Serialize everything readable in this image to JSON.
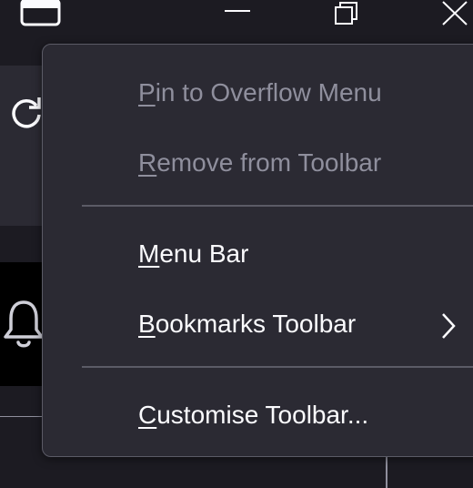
{
  "window": {
    "controls": {
      "minimize_icon": "minimize-icon",
      "restore_icon": "restore-icon",
      "close_icon": "close-icon"
    }
  },
  "background_icons": [
    "reload-icon",
    "bell-icon",
    "window-icon"
  ],
  "context_menu": {
    "items": [
      {
        "mnemonic": "P",
        "rest": "in to Overflow Menu",
        "enabled": false
      },
      {
        "mnemonic": "R",
        "rest": "emove from Toolbar",
        "enabled": false
      },
      {
        "mnemonic": "M",
        "rest": "enu Bar",
        "enabled": true
      },
      {
        "mnemonic": "B",
        "rest": "ookmarks Toolbar",
        "enabled": true,
        "submenu": true
      },
      {
        "mnemonic": "C",
        "rest": "ustomise Toolbar...",
        "enabled": true
      }
    ]
  },
  "colors": {
    "menu_bg": "#2b2a33",
    "text": "#fbfbfe",
    "disabled_text": "#8f8f9d",
    "separator": "#5b5b66"
  }
}
